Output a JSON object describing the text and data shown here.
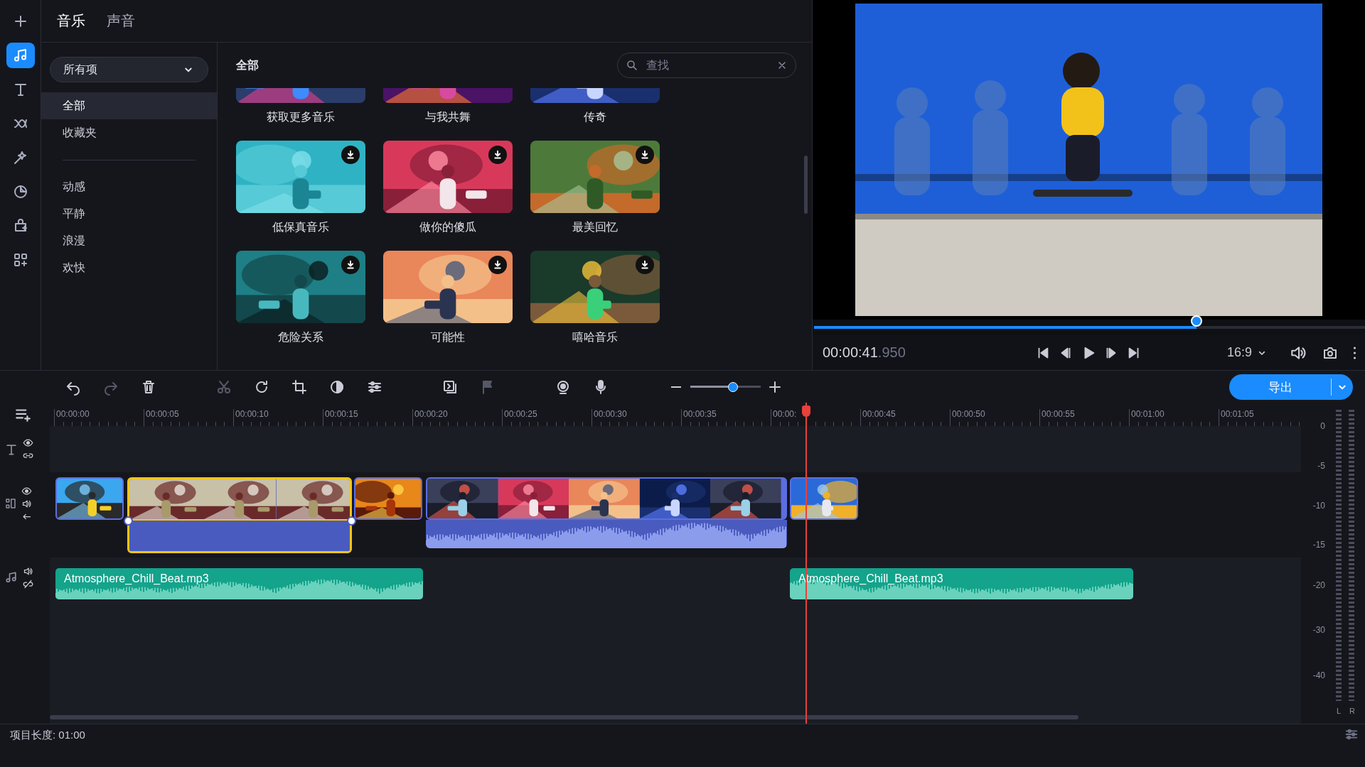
{
  "rail": [
    {
      "kind": "add",
      "selected": false
    },
    {
      "kind": "music",
      "selected": true
    },
    {
      "kind": "text",
      "selected": false
    },
    {
      "kind": "transition",
      "selected": false
    },
    {
      "kind": "magic",
      "selected": false
    },
    {
      "kind": "sticker",
      "selected": false
    },
    {
      "kind": "store",
      "selected": false
    },
    {
      "kind": "apps",
      "selected": false
    }
  ],
  "tabs": [
    {
      "label": "音乐",
      "selected": true
    },
    {
      "label": "声音",
      "selected": false
    }
  ],
  "sidebar": {
    "filter": "所有项",
    "items": [
      {
        "label": "全部",
        "selected": true
      },
      {
        "label": "收藏夹",
        "selected": false
      }
    ],
    "moods": [
      {
        "label": "动感",
        "selected": false
      },
      {
        "label": "平静",
        "selected": false
      },
      {
        "label": "浪漫",
        "selected": false
      },
      {
        "label": "欢快",
        "selected": false
      }
    ]
  },
  "library": {
    "title": "全部",
    "search": {
      "placeholder": "查找"
    },
    "cards": [
      {
        "title": "获取更多音乐"
      },
      {
        "title": "与我共舞"
      },
      {
        "title": "传奇"
      },
      {
        "title": "低保真音乐"
      },
      {
        "title": "做你的傻瓜"
      },
      {
        "title": "最美回忆"
      },
      {
        "title": "危险关系"
      },
      {
        "title": "可能性"
      },
      {
        "title": "嘻哈音乐"
      }
    ]
  },
  "preview": {
    "level": 0.694,
    "time": "00:00:41",
    "time_fraction": ".950",
    "aspect": "16:9",
    "controls": [
      {
        "kind": "skip-start"
      },
      {
        "kind": "step-back"
      },
      {
        "kind": "play"
      },
      {
        "kind": "step-forward"
      },
      {
        "kind": "skip-end"
      }
    ]
  },
  "toolbar": {
    "groups": [
      [
        {
          "kind": "undo",
          "disabled": false
        },
        {
          "kind": "redo",
          "disabled": true
        },
        {
          "kind": "delete",
          "disabled": false
        }
      ],
      [
        {
          "kind": "cut",
          "disabled": true
        },
        {
          "kind": "rotate",
          "disabled": false
        },
        {
          "kind": "crop",
          "disabled": false
        },
        {
          "kind": "color",
          "disabled": false
        },
        {
          "kind": "adjust",
          "disabled": false
        }
      ],
      [
        {
          "kind": "overlay",
          "disabled": false
        },
        {
          "kind": "flag",
          "disabled": true
        }
      ],
      [
        {
          "kind": "webcam",
          "disabled": false
        },
        {
          "kind": "mic",
          "disabled": false
        }
      ]
    ],
    "zoom": {
      "level": 0.61
    },
    "export": "导出"
  },
  "timeline": {
    "ruler": [
      "00:00:00",
      "00:00:05",
      "00:00:10",
      "00:00:15",
      "00:00:20",
      "00:00:25",
      "00:00:30",
      "00:00:35",
      "00:00:",
      "00:00:45",
      "00:00:50",
      "00:00:55",
      "00:01:00",
      "00:01:05"
    ],
    "tracks": [
      {
        "kind": "text"
      },
      {
        "kind": "video",
        "clips": [
          {
            "kind": "plain",
            "selected": false
          },
          {
            "kind": "linked",
            "selected": true
          },
          {
            "kind": "plain",
            "selected": false
          },
          {
            "kind": "waveform",
            "selected": false
          },
          {
            "kind": "plain",
            "selected": false
          }
        ]
      },
      {
        "kind": "audio",
        "clips": [
          {
            "label": "Atmosphere_Chill_Beat.mp3"
          },
          {
            "label": "Atmosphere_Chill_Beat.mp3"
          }
        ]
      }
    ],
    "meter": {
      "scale": [
        "0",
        "-5",
        "-10",
        "-15",
        "-20",
        "-30",
        "-40"
      ],
      "channels": [
        "L",
        "R"
      ]
    }
  },
  "status": "项目长度: 01:00"
}
